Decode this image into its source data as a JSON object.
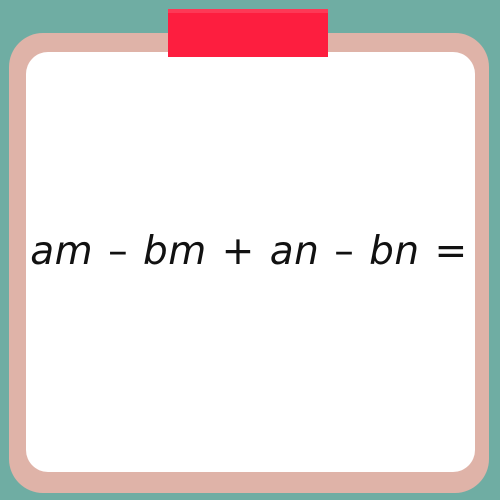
{
  "card": {
    "frame_color": "#dfb3a8",
    "inner_color": "#ffffff",
    "tape_color": "#fd1e3f",
    "background_color": "#6fada3"
  },
  "expression": {
    "term1": "am",
    "op1": "–",
    "term2": "bm",
    "op2": "+",
    "term3": "an",
    "op3": "–",
    "term4": "bn",
    "op4": "="
  }
}
